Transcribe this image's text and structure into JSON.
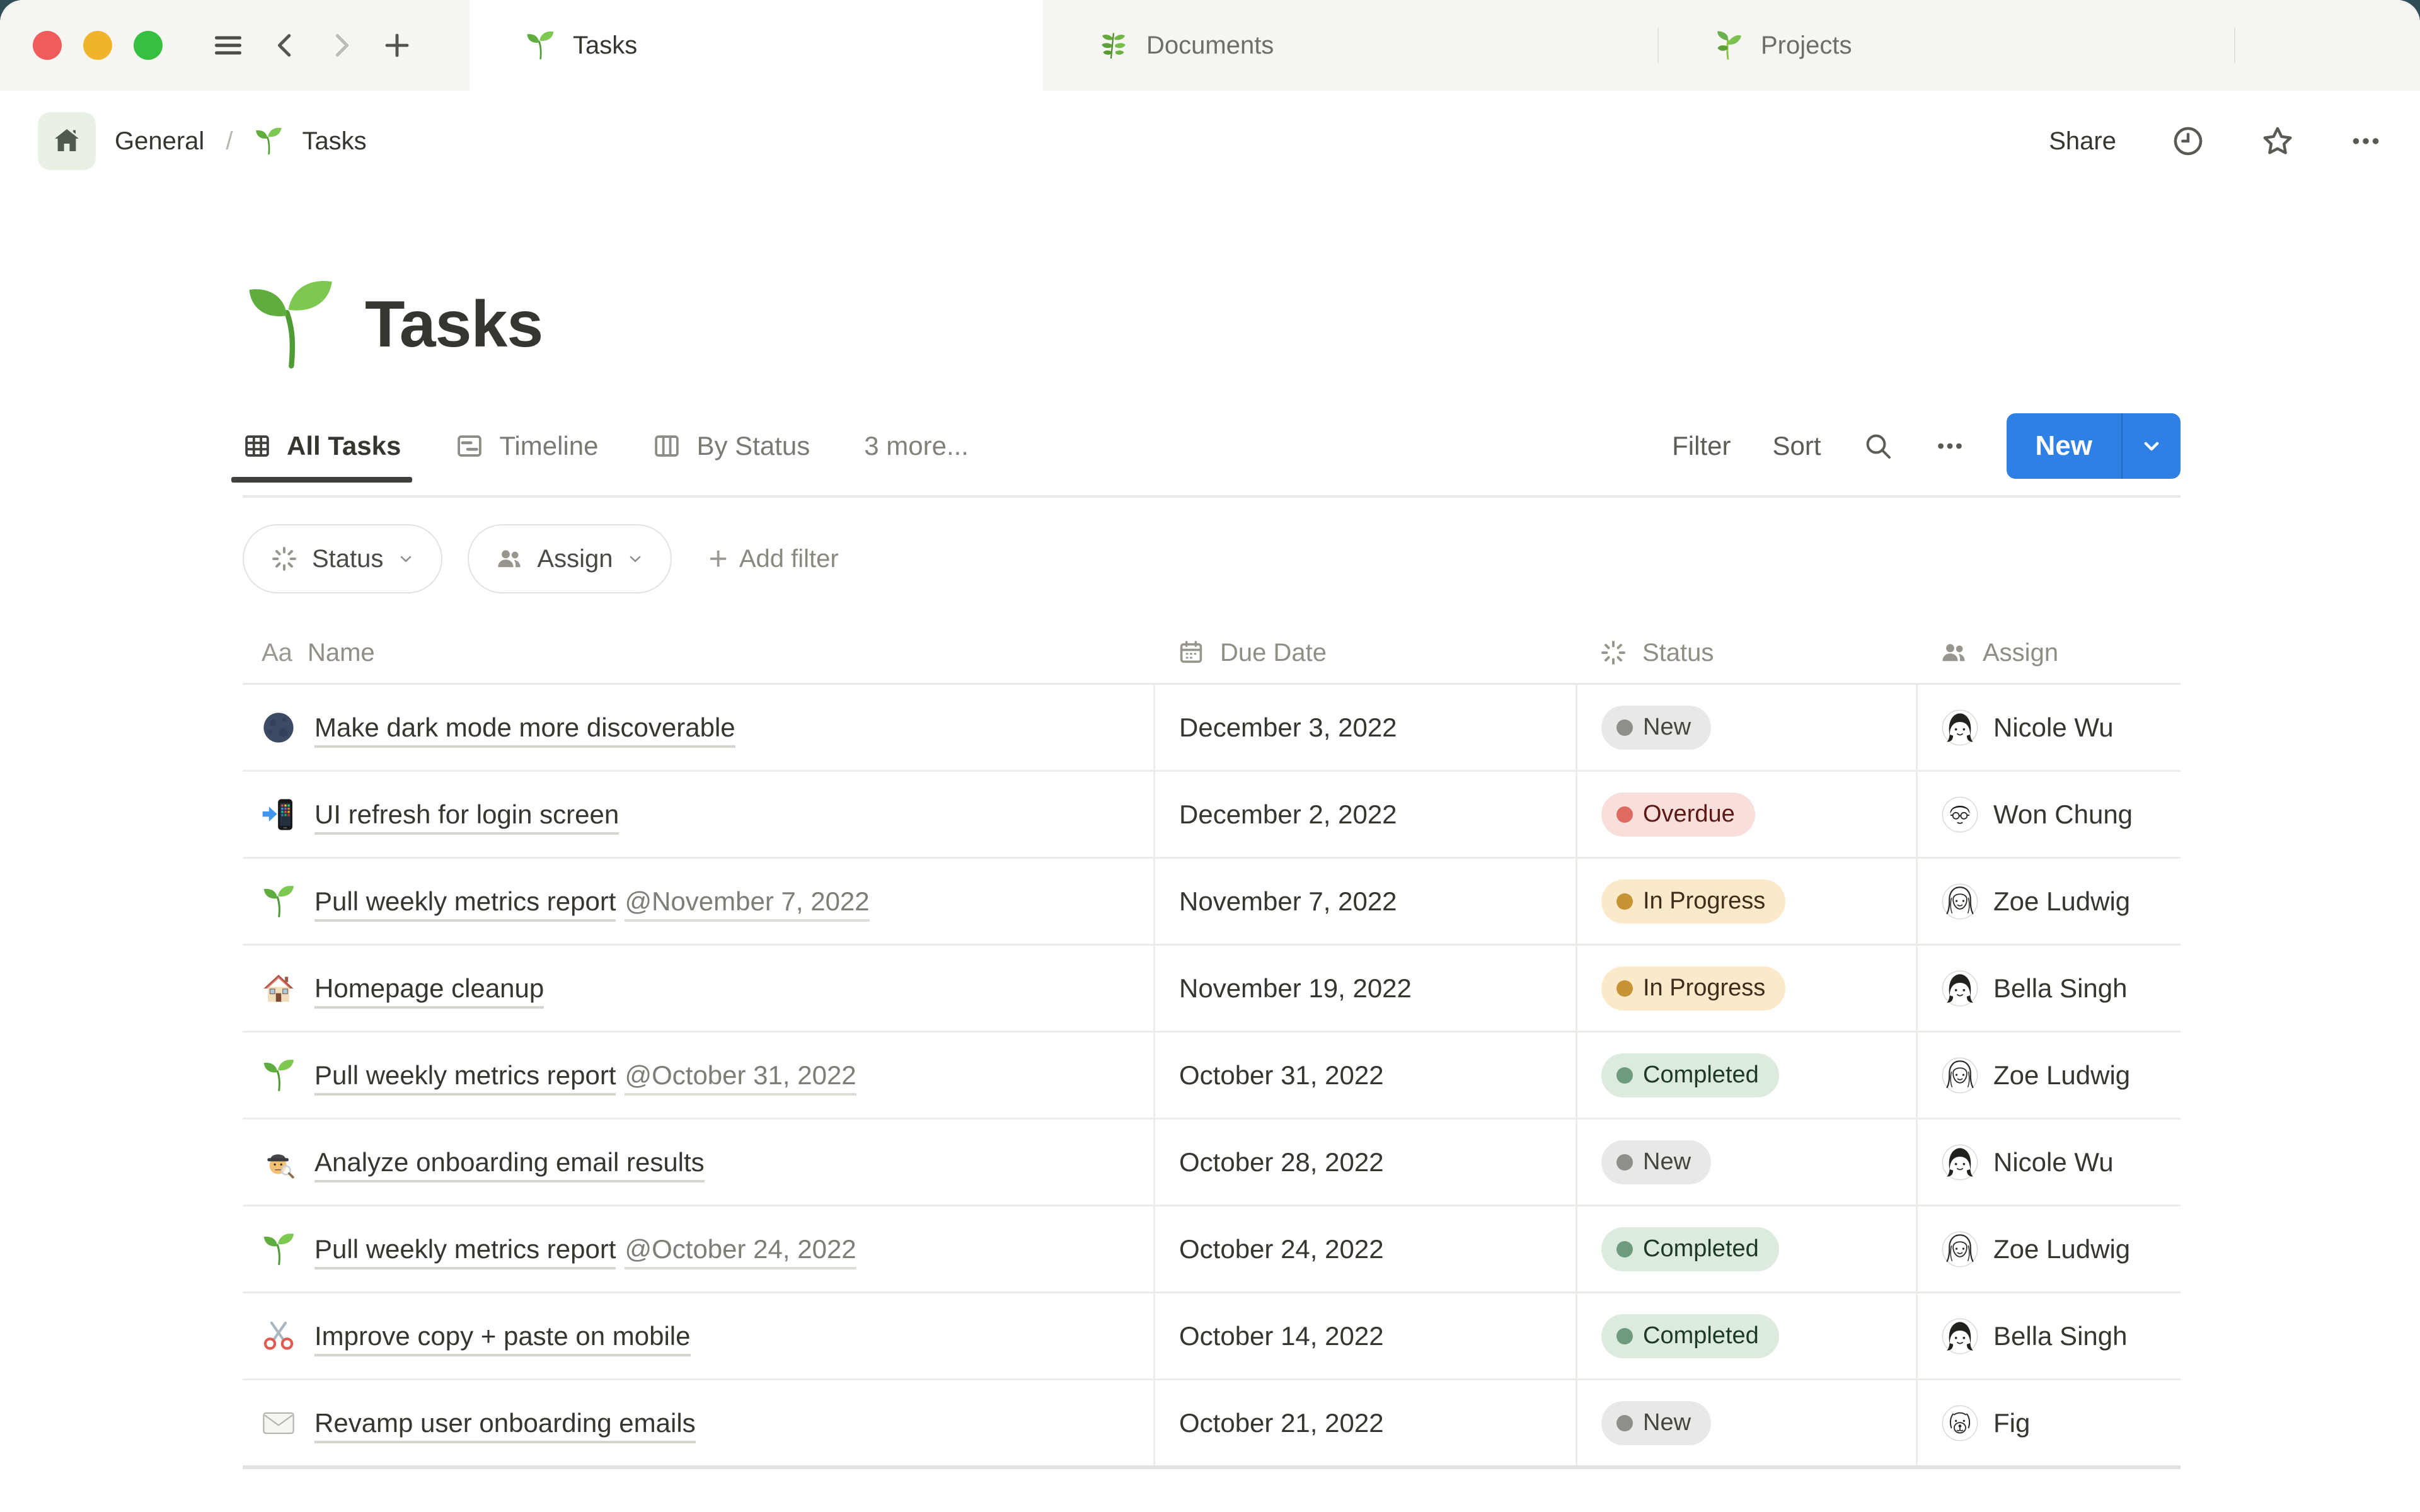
{
  "colors": {
    "accent_blue": "#2f80e4",
    "window_backdrop": "#2e4d57",
    "tabbar_bg": "#f6f5f2",
    "status_palette": {
      "gray": {
        "bg": "#e9e8e6",
        "dot": "#8f8e8b",
        "text": "#45443f"
      },
      "red": {
        "bg": "#f8dfdc",
        "dot": "#dd6b62",
        "text": "#5d1715"
      },
      "yellow": {
        "bg": "#fbe9ca",
        "dot": "#c79434",
        "text": "#3f2c1a"
      },
      "green": {
        "bg": "#dcebdd",
        "dot": "#6d9b7d",
        "text": "#1d3829"
      }
    }
  },
  "window": {
    "controls": [
      "close",
      "minimize",
      "zoom"
    ],
    "nav": [
      "menu",
      "back",
      "forward",
      "new-tab"
    ],
    "tabs": [
      {
        "label": "Tasks",
        "icon": "seedling",
        "active": true
      },
      {
        "label": "Documents",
        "icon": "herb",
        "active": false
      },
      {
        "label": "Projects",
        "icon": "leafy",
        "active": false
      }
    ]
  },
  "breadcrumb": {
    "root": "General",
    "separator": "/",
    "current": "Tasks"
  },
  "topbar": {
    "share": "Share"
  },
  "page": {
    "title": "Tasks",
    "icon": "seedling"
  },
  "views": {
    "tabs": [
      {
        "label": "All Tasks",
        "icon": "grid",
        "active": true
      },
      {
        "label": "Timeline",
        "icon": "timeline",
        "active": false
      },
      {
        "label": "By Status",
        "icon": "board",
        "active": false
      }
    ],
    "more": "3 more...",
    "filter": "Filter",
    "sort": "Sort",
    "new_label": "New"
  },
  "filters": {
    "chips": [
      {
        "label": "Status",
        "icon": "burst"
      },
      {
        "label": "Assign",
        "icon": "people"
      }
    ],
    "add_plus": "+",
    "add_label": "Add filter"
  },
  "table": {
    "columns": [
      {
        "label": "Name",
        "icon": "aa"
      },
      {
        "label": "Due Date",
        "icon": "calendar"
      },
      {
        "label": "Status",
        "icon": "burst"
      },
      {
        "label": "Assign",
        "icon": "people"
      }
    ],
    "rows": [
      {
        "icon": "moon",
        "name": "Make dark mode more discoverable",
        "mention": "",
        "due": "December 3, 2022",
        "status": "New",
        "status_color": "gray",
        "assignee": "Nicole Wu",
        "avatar": "woman-dark"
      },
      {
        "icon": "phone",
        "name": "UI refresh for login screen",
        "mention": "",
        "due": "December 2, 2022",
        "status": "Overdue",
        "status_color": "red",
        "assignee": "Won Chung",
        "avatar": "man"
      },
      {
        "icon": "seedling",
        "name": "Pull weekly metrics report",
        "mention": "@November 7, 2022",
        "due": "November 7, 2022",
        "status": "In Progress",
        "status_color": "yellow",
        "assignee": "Zoe Ludwig",
        "avatar": "woman-long"
      },
      {
        "icon": "house",
        "name": "Homepage cleanup",
        "mention": "",
        "due": "November 19, 2022",
        "status": "In Progress",
        "status_color": "yellow",
        "assignee": "Bella Singh",
        "avatar": "woman-dark"
      },
      {
        "icon": "seedling",
        "name": "Pull weekly metrics report",
        "mention": "@October 31, 2022",
        "due": "October 31, 2022",
        "status": "Completed",
        "status_color": "green",
        "assignee": "Zoe Ludwig",
        "avatar": "woman-long"
      },
      {
        "icon": "detective",
        "name": "Analyze onboarding email results",
        "mention": "",
        "due": "October 28, 2022",
        "status": "New",
        "status_color": "gray",
        "assignee": "Nicole Wu",
        "avatar": "woman-dark"
      },
      {
        "icon": "seedling",
        "name": "Pull weekly metrics report",
        "mention": "@October 24, 2022",
        "due": "October 24, 2022",
        "status": "Completed",
        "status_color": "green",
        "assignee": "Zoe Ludwig",
        "avatar": "woman-long"
      },
      {
        "icon": "scissors",
        "name": "Improve copy + paste on mobile",
        "mention": "",
        "due": "October 14, 2022",
        "status": "Completed",
        "status_color": "green",
        "assignee": "Bella Singh",
        "avatar": "woman-dark"
      },
      {
        "icon": "envelope",
        "name": "Revamp user onboarding emails",
        "mention": "",
        "due": "October 21, 2022",
        "status": "New",
        "status_color": "gray",
        "assignee": "Fig",
        "avatar": "dog"
      }
    ]
  }
}
